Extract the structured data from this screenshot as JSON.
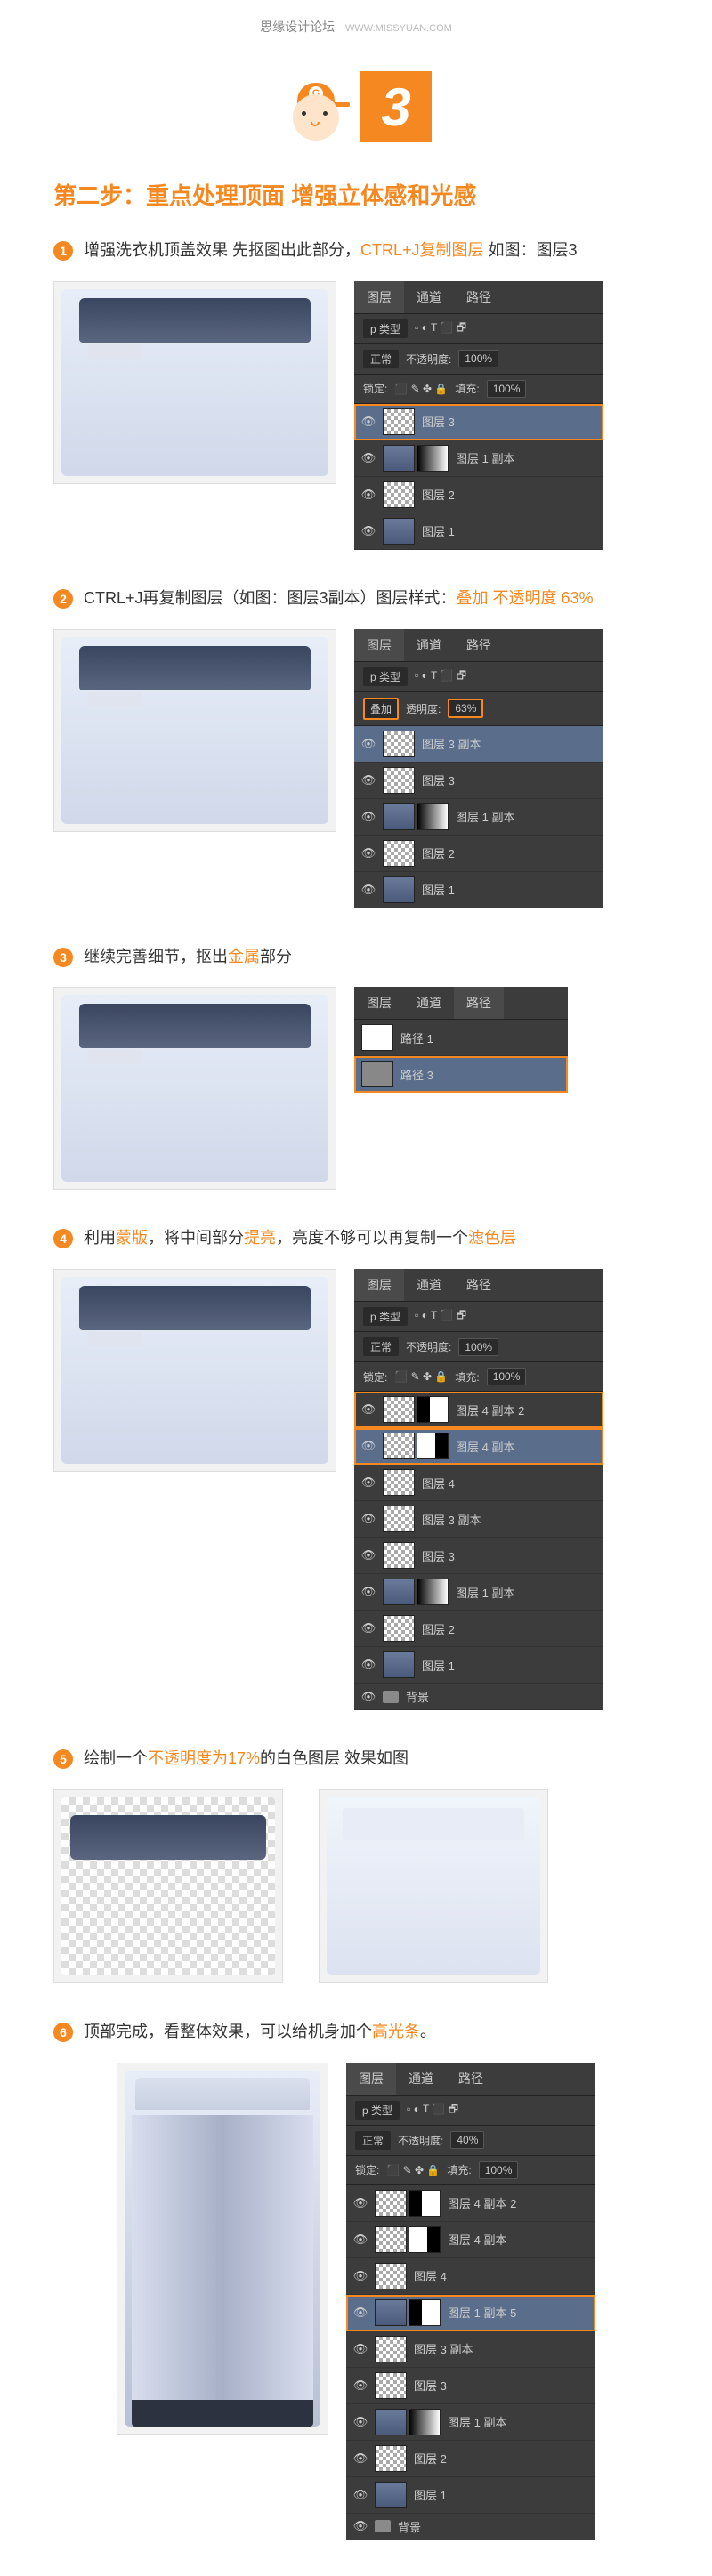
{
  "watermark": {
    "text": "思缘设计论坛",
    "link": "WWW.MISSYUAN.COM"
  },
  "badge": {
    "number": "3",
    "logo": "G"
  },
  "section_title": "第二步：重点处理顶面 增强立体感和光感",
  "steps": [
    {
      "num": "1",
      "text_parts": [
        "增强洗衣机顶盖效果 先抠图出此部分，",
        "CTRL+J复制图层",
        " 如图：图层3"
      ],
      "highlight_idx": [
        1
      ]
    },
    {
      "num": "2",
      "text_parts": [
        "CTRL+J再复制图层（如图：图层3副本）图层样式：",
        "叠加 不透明度 63%"
      ],
      "highlight_idx": [
        1
      ]
    },
    {
      "num": "3",
      "text_parts": [
        "继续完善细节，抠出",
        "金属",
        "部分"
      ],
      "highlight_idx": [
        1
      ]
    },
    {
      "num": "4",
      "text_parts": [
        "利用",
        "蒙版",
        "，将中间部分",
        "提亮",
        "，亮度不够可以再复制一个",
        "滤色层"
      ],
      "highlight_idx": [
        1,
        3,
        5
      ]
    },
    {
      "num": "5",
      "text_parts": [
        "绘制一个",
        "不透明度为17%",
        "的白色图层 效果如图"
      ],
      "highlight_idx": [
        1
      ]
    },
    {
      "num": "6",
      "text_parts": [
        "顶部完成，看整体效果，可以给机身加个",
        "高光条",
        "。"
      ],
      "highlight_idx": [
        1
      ]
    }
  ],
  "panel_labels": {
    "tabs": {
      "layers": "图层",
      "channels": "通道",
      "paths": "路径"
    },
    "type_label": "p 类型",
    "opacity_label": "不透明度:",
    "fill_label": "填充:",
    "lock_label": "锁定:",
    "blend_normal": "正常",
    "blend_overlay": "叠加",
    "opacity_100": "100%",
    "opacity_63": "63%",
    "opacity_40": "40%",
    "transparency_label": "透明度:"
  },
  "layers": {
    "p1": [
      "图层 3",
      "图层 1 副本",
      "图层 2",
      "图层 1"
    ],
    "p2": [
      "图层 3 副本",
      "图层 3",
      "图层 1 副本",
      "图层 2",
      "图层 1"
    ],
    "p3_paths": [
      "路径 1",
      "路径 3"
    ],
    "p4": [
      "图层 4 副本 2",
      "图层 4 副本",
      "图层 4",
      "图层 3 副本",
      "图层 3",
      "图层 1 副本",
      "图层 2",
      "图层 1",
      "背景"
    ],
    "p6": [
      "图层 4 副本 2",
      "图层 4 副本",
      "图层 4",
      "图层 1 副本 5",
      "图层 3 副本",
      "图层 3",
      "图层 1 副本",
      "图层 2",
      "图层 1",
      "背景"
    ]
  }
}
